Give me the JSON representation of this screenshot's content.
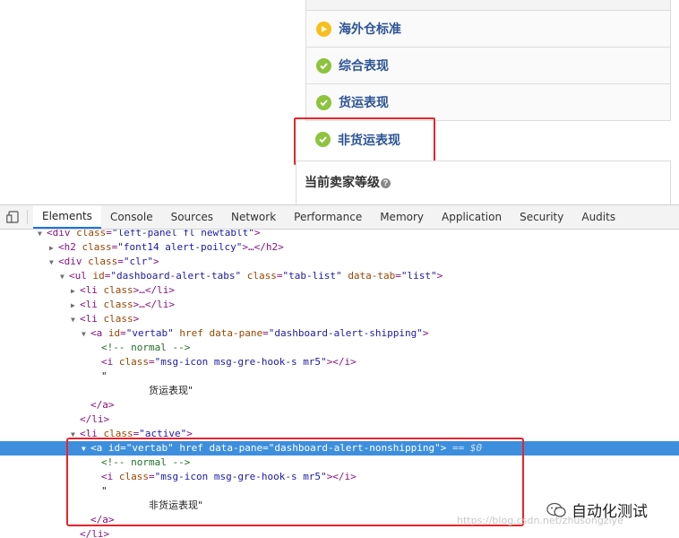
{
  "panel": {
    "items": [
      {
        "label": "海外仓标准",
        "icon": "play-icon",
        "color": "#f7bf1e"
      },
      {
        "label": "综合表现",
        "icon": "check-icon",
        "color": "#8cc43d"
      },
      {
        "label": "货运表现",
        "icon": "check-icon",
        "color": "#8cc43d"
      },
      {
        "label": "非货运表现",
        "icon": "check-icon",
        "color": "#8cc43d"
      }
    ],
    "seller_level": "当前卖家等级",
    "help": "?"
  },
  "devtools": {
    "tabs": [
      "Elements",
      "Console",
      "Sources",
      "Network",
      "Performance",
      "Memory",
      "Application",
      "Security",
      "Audits"
    ],
    "active_tab": "Elements"
  },
  "dom": {
    "l0": {
      "tag_open": "<div ",
      "a1": "class",
      "v1": "\"left-panel fl newtablt\"",
      "close": ">"
    },
    "l1": {
      "tag_open": "<h2 ",
      "a1": "class",
      "v1": "\"font14 alert-poilcy\"",
      "close": ">…</h2>"
    },
    "l2": {
      "tag_open": "<div ",
      "a1": "class",
      "v1": "\"clr\"",
      "close": ">"
    },
    "l3": {
      "tag_open": "<ul ",
      "a1": "id",
      "v1": "\"dashboard-alert-tabs\"",
      "a2": "class",
      "v2": "\"tab-list\"",
      "a3": "data-tab",
      "v3": "\"list\"",
      "close": ">"
    },
    "l4": {
      "tag": "<li ",
      "attr": "class",
      "close": ">…</li>"
    },
    "l5": {
      "tag": "<li ",
      "attr": "class",
      "close": ">…</li>"
    },
    "l6": {
      "tag": "<li ",
      "attr": "class",
      "close": ">"
    },
    "l7": {
      "tag_open": "<a ",
      "a1": "id",
      "v1": "\"vertab\"",
      "a2": "href",
      "a3": "data-pane",
      "v3": "\"dashboard-alert-shipping\"",
      "close": ">"
    },
    "l8": {
      "comment": "<!-- normal -->"
    },
    "l9": {
      "tag_open": "<i ",
      "a1": "class",
      "v1": "\"msg-icon msg-gre-hook-s mr5\"",
      "close": "></i>"
    },
    "l10": {
      "quote": "\""
    },
    "l11": {
      "text": "货运表现\""
    },
    "l12": {
      "close": "</a>"
    },
    "l13": {
      "close": "</li>"
    },
    "l14": {
      "tag_open": "<li ",
      "a1": "class",
      "v1": "\"active\"",
      "close": ">"
    },
    "l15": {
      "tag_open": "<a ",
      "a1": "id",
      "v1": "\"vertab\"",
      "a2": "href",
      "a3": "data-pane",
      "v3": "\"dashboard-alert-nonshipping\"",
      "close": ">",
      "suffix": " == $0"
    },
    "l16": {
      "comment": "<!-- normal -->"
    },
    "l17": {
      "tag_open": "<i ",
      "a1": "class",
      "v1": "\"msg-icon msg-gre-hook-s mr5\"",
      "close": "></i>"
    },
    "l18": {
      "quote": "\""
    },
    "l19": {
      "text": "非货运表现\""
    },
    "l20": {
      "close": "</a>"
    },
    "l21": {
      "close": "</li>"
    }
  },
  "watermark": {
    "text": "自动化测试",
    "url": "https://blog.csdn.net/zhusongziye"
  }
}
